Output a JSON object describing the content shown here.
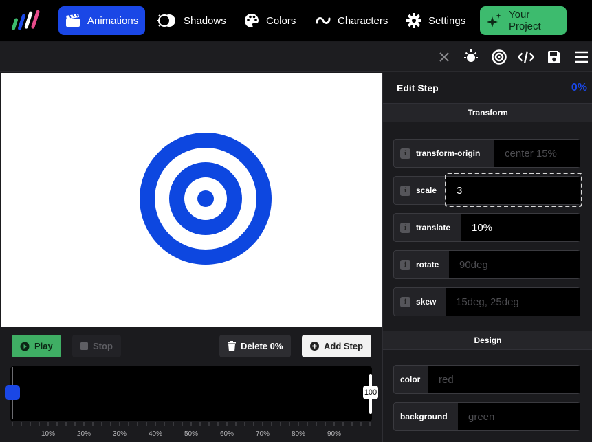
{
  "nav": {
    "items": [
      {
        "label": "Animations",
        "icon": "clapperboard-icon",
        "active": true
      },
      {
        "label": "Shadows",
        "icon": "shadow-icon"
      },
      {
        "label": "Colors",
        "icon": "palette-icon"
      },
      {
        "label": "Characters",
        "icon": "tilde-icon"
      },
      {
        "label": "Settings",
        "icon": "gear-icon"
      }
    ],
    "project_label": "Your Project"
  },
  "colors": {
    "accent": "#1a47e6",
    "green": "#3dbb6e",
    "stage": "#ffffff"
  },
  "controls": {
    "play_label": "Play",
    "stop_label": "Stop",
    "delete_label": "Delete 0%",
    "add_step_label": "Add Step",
    "end_handle_label": "100",
    "ticks": [
      "10%",
      "20%",
      "30%",
      "40%",
      "50%",
      "60%",
      "70%",
      "80%",
      "90%"
    ]
  },
  "panel": {
    "title": "Edit Step",
    "percent": "0%",
    "transform_title": "Transform",
    "design_title": "Design",
    "transform_props": [
      {
        "label": "transform-origin",
        "value": "",
        "placeholder": "center 15%"
      },
      {
        "label": "scale",
        "value": "3",
        "placeholder": ""
      },
      {
        "label": "translate",
        "value": "10%",
        "placeholder": ""
      },
      {
        "label": "rotate",
        "value": "",
        "placeholder": "90deg"
      },
      {
        "label": "skew",
        "value": "",
        "placeholder": "15deg, 25deg"
      }
    ],
    "design_props": [
      {
        "label": "color",
        "value": "",
        "placeholder": "red"
      },
      {
        "label": "background",
        "value": "",
        "placeholder": "green"
      }
    ]
  }
}
